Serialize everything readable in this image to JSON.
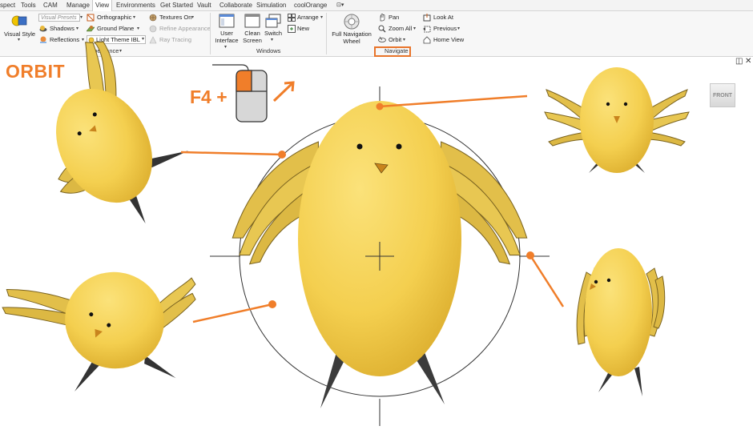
{
  "tabs": [
    "spect",
    "Tools",
    "CAM",
    "Manage",
    "View",
    "Environments",
    "Get Started",
    "Vault",
    "Collaborate",
    "Simulation",
    "coolOrange"
  ],
  "active_tab": "View",
  "appearance": {
    "visual_style": "Visual Style",
    "visual_presets": "Visual Presets",
    "shadows": "Shadows",
    "reflections": "Reflections",
    "orthographic": "Orthographic",
    "ground_plane": "Ground Plane",
    "lighting": "Light Theme IBL",
    "textures": "Textures On",
    "refine": "Refine Appearance",
    "ray_tracing": "Ray Tracing",
    "panel": "Appearance"
  },
  "windows": {
    "user_interface_1": "User",
    "user_interface_2": "Interface",
    "clean_screen_1": "Clean",
    "clean_screen_2": "Screen",
    "switch": "Switch",
    "arrange": "Arrange",
    "new": "New",
    "panel": "Windows"
  },
  "navigate": {
    "full_nav_1": "Full Navigation",
    "full_nav_2": "Wheel",
    "pan": "Pan",
    "zoom_all": "Zoom All",
    "orbit": "Orbit",
    "look_at": "Look At",
    "previous": "Previous",
    "home_view": "Home View",
    "panel": "Navigate"
  },
  "viewport": {
    "title": "ORBIT",
    "shortcut": "F4 +",
    "viewcube": "FRONT",
    "restore": "◫",
    "close": "✕"
  },
  "colors": {
    "accent": "#f07e2a",
    "chick_body": "#f4cf4f",
    "wing": "#e2bf4a"
  }
}
